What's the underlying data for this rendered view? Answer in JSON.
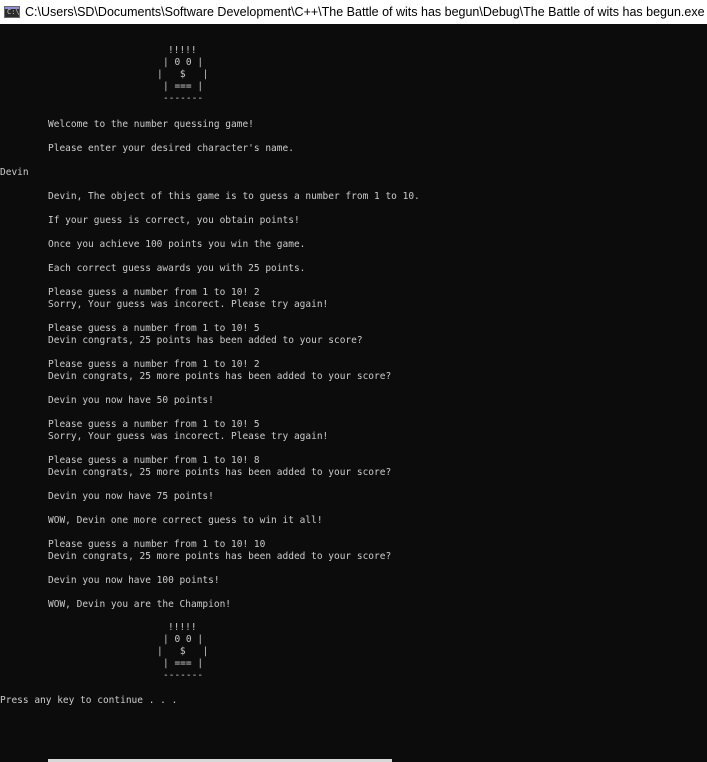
{
  "window": {
    "title": "C:\\Users\\SD\\Documents\\Software Development\\C++\\The Battle of wits has begun\\Debug\\The Battle of wits has begun.exe",
    "icon": "console-app-icon"
  },
  "console": {
    "art_top": [
      "!!!!!",
      "| 0 0 |",
      "|   $   |",
      "| === |",
      "-------"
    ],
    "welcome": "Welcome to the number quessing game!",
    "prompt_name": "Please enter your desired character's name.",
    "user_name_input": "Devin",
    "intro": [
      "Devin, The object of this game is to guess a number from 1 to 10.",
      "If your guess is correct, you obtain points!",
      "Once you achieve 100 points you win the game.",
      "Each correct guess awards you with 25 points."
    ],
    "rounds": [
      {
        "prompt": "Please guess a number from 1 to 10! 2",
        "result": "Sorry, Your guess was incorect. Please try again!"
      },
      {
        "prompt": "Please guess a number from 1 to 10! 5",
        "result": "Devin congrats, 25 points has been added to your score?"
      },
      {
        "prompt": "Please guess a number from 1 to 10! 2",
        "result": "Devin congrats, 25 more points has been added to your score?"
      },
      {
        "prompt": "Please guess a number from 1 to 10! 5",
        "result": "Sorry, Your guess was incorect. Please try again!"
      },
      {
        "prompt": "Please guess a number from 1 to 10! 8",
        "result": "Devin congrats, 25 more points has been added to your score?"
      },
      {
        "prompt": "Please guess a number from 1 to 10! 10",
        "result": "Devin congrats, 25 more points has been added to your score?"
      }
    ],
    "status": {
      "points_50": "Devin you now have 50 points!",
      "points_75": "Devin you now have 75 points!",
      "one_more": "WOW, Devin one more correct guess to win it all!",
      "points_100": "Devin you now have 100 points!",
      "champion": "WOW, Devin you are the Champion!"
    },
    "art_bottom": [
      "!!!!!",
      "| 0 0 |",
      "|   $   |",
      "| === |",
      "-------"
    ],
    "press_key": "Press any key to continue . . ."
  },
  "colors": {
    "console_bg": "#0c0c0c",
    "console_text": "#cccccc",
    "titlebar_bg": "#ffffff",
    "scroll_thumb": "#d8d8d8"
  }
}
